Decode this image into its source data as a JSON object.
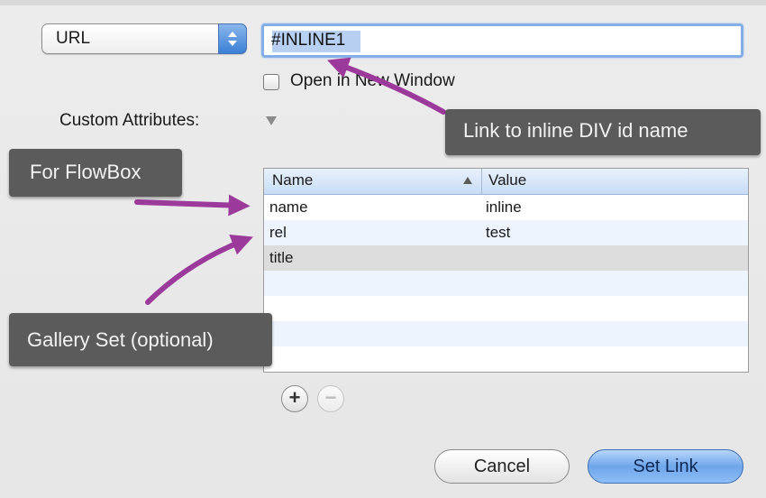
{
  "link_type": {
    "selected": "URL"
  },
  "url_field": {
    "value": "#INLINE1"
  },
  "open_new_window": {
    "label": "Open in New Window",
    "checked": false
  },
  "custom_attributes": {
    "label": "Custom Attributes:"
  },
  "attributes_table": {
    "columns": [
      "Name",
      "Value"
    ],
    "rows": [
      {
        "name": "name",
        "value": "inline"
      },
      {
        "name": "rel",
        "value": "test"
      },
      {
        "name": "title",
        "value": ""
      }
    ]
  },
  "table_controls": {
    "add": "+",
    "remove": "−"
  },
  "buttons": {
    "cancel": "Cancel",
    "set_link": "Set Link"
  },
  "annotations": {
    "link_to_inline": "Link to inline DIV id name",
    "for_flowbox": "For FlowBox",
    "gallery_set": "Gallery Set (optional)"
  },
  "colors": {
    "callout_bg": "#5b5b5b",
    "arrow": "#9b3a9b",
    "focus_ring": "#86aee6",
    "row_stripe": "#eef4fd",
    "selected_row": "#dcdcdc"
  }
}
